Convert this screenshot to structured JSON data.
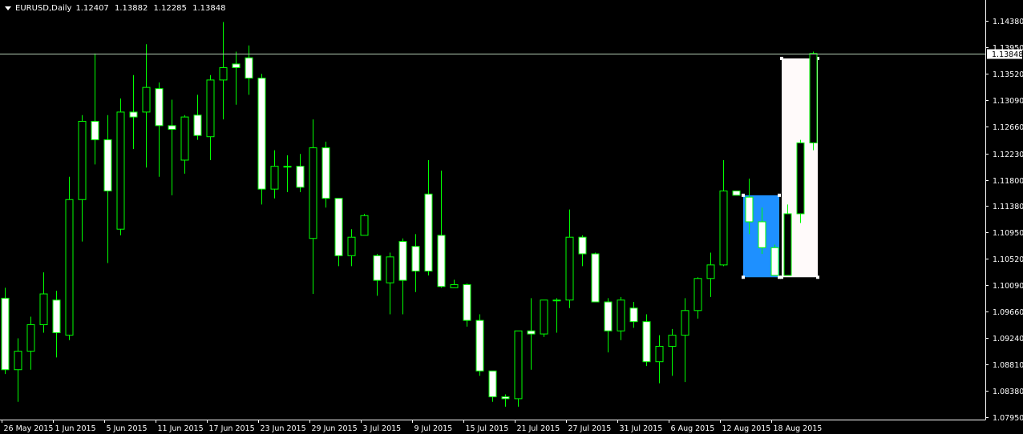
{
  "header": {
    "symbol_timeframe": "EURUSD,Daily",
    "open": "1.12407",
    "high": "1.13882",
    "low": "1.12285",
    "close": "1.13848"
  },
  "chart_data": {
    "type": "candlestick",
    "symbol": "EURUSD",
    "timeframe": "Daily",
    "ylim": [
      1.0775,
      1.1455
    ],
    "y_ticks": [
      "1.14380",
      "1.13950",
      "1.13520",
      "1.13090",
      "1.12660",
      "1.12230",
      "1.11800",
      "1.11380",
      "1.10950",
      "1.10520",
      "1.10090",
      "1.09660",
      "1.09240",
      "1.08810",
      "1.08380",
      "1.07950"
    ],
    "x_ticks": [
      {
        "label": "26 May 2015",
        "index": 0
      },
      {
        "label": "1 Jun 2015",
        "index": 4
      },
      {
        "label": "5 Jun 2015",
        "index": 8
      },
      {
        "label": "11 Jun 2015",
        "index": 12
      },
      {
        "label": "17 Jun 2015",
        "index": 16
      },
      {
        "label": "23 Jun 2015",
        "index": 20
      },
      {
        "label": "29 Jun 2015",
        "index": 24
      },
      {
        "label": "3 Jul 2015",
        "index": 28
      },
      {
        "label": "9 Jul 2015",
        "index": 32
      },
      {
        "label": "15 Jul 2015",
        "index": 36
      },
      {
        "label": "21 Jul 2015",
        "index": 40
      },
      {
        "label": "27 Jul 2015",
        "index": 44
      },
      {
        "label": "31 Jul 2015",
        "index": 48
      },
      {
        "label": "6 Aug 2015",
        "index": 52
      },
      {
        "label": "12 Aug 2015",
        "index": 56
      },
      {
        "label": "18 Aug 2015",
        "index": 60
      }
    ],
    "current_price": "1.13848",
    "current_price_value": 1.13848,
    "colors": {
      "background": "#000000",
      "bull_body": "#000000",
      "bear_body": "#ffffff",
      "candle_outline": "#00ff00",
      "axis": "#ffffff",
      "price_line": "#b4cdb4",
      "selection_blue": "#1e90ff",
      "selection_white": "#fffafa"
    },
    "candles": [
      {
        "o": 1.0988,
        "h": 1.1005,
        "l": 1.0865,
        "c": 1.0872
      },
      {
        "o": 1.0872,
        "h": 1.0923,
        "l": 1.082,
        "c": 1.0902
      },
      {
        "o": 1.0902,
        "h": 1.0958,
        "l": 1.0872,
        "c": 1.0945
      },
      {
        "o": 1.0945,
        "h": 1.103,
        "l": 1.0932,
        "c": 1.0995
      },
      {
        "o": 1.0985,
        "h": 1.1,
        "l": 1.0892,
        "c": 1.0932
      },
      {
        "o": 1.0928,
        "h": 1.1185,
        "l": 1.092,
        "c": 1.1148
      },
      {
        "o": 1.1148,
        "h": 1.1285,
        "l": 1.108,
        "c": 1.1275
      },
      {
        "o": 1.1275,
        "h": 1.1385,
        "l": 1.1205,
        "c": 1.1245
      },
      {
        "o": 1.1245,
        "h": 1.1285,
        "l": 1.1045,
        "c": 1.1162
      },
      {
        "o": 1.11,
        "h": 1.1312,
        "l": 1.109,
        "c": 1.129
      },
      {
        "o": 1.129,
        "h": 1.135,
        "l": 1.123,
        "c": 1.1282
      },
      {
        "o": 1.129,
        "h": 1.14,
        "l": 1.12,
        "c": 1.133
      },
      {
        "o": 1.1328,
        "h": 1.1338,
        "l": 1.1185,
        "c": 1.1268
      },
      {
        "o": 1.1268,
        "h": 1.131,
        "l": 1.1155,
        "c": 1.1262
      },
      {
        "o": 1.1212,
        "h": 1.1285,
        "l": 1.119,
        "c": 1.1282
      },
      {
        "o": 1.1285,
        "h": 1.1318,
        "l": 1.1245,
        "c": 1.1252
      },
      {
        "o": 1.125,
        "h": 1.135,
        "l": 1.1212,
        "c": 1.1342
      },
      {
        "o": 1.1342,
        "h": 1.1436,
        "l": 1.1278,
        "c": 1.1362
      },
      {
        "o": 1.1368,
        "h": 1.1388,
        "l": 1.1302,
        "c": 1.1362
      },
      {
        "o": 1.1378,
        "h": 1.1398,
        "l": 1.1318,
        "c": 1.1345
      },
      {
        "o": 1.1345,
        "h": 1.1352,
        "l": 1.114,
        "c": 1.1165
      },
      {
        "o": 1.1165,
        "h": 1.1228,
        "l": 1.115,
        "c": 1.1202
      },
      {
        "o": 1.1202,
        "h": 1.122,
        "l": 1.116,
        "c": 1.1202
      },
      {
        "o": 1.1202,
        "h": 1.1222,
        "l": 1.116,
        "c": 1.1168
      },
      {
        "o": 1.1085,
        "h": 1.1278,
        "l": 1.0995,
        "c": 1.1232
      },
      {
        "o": 1.1232,
        "h": 1.1242,
        "l": 1.1135,
        "c": 1.115
      },
      {
        "o": 1.115,
        "h": 1.115,
        "l": 1.104,
        "c": 1.1057
      },
      {
        "o": 1.1057,
        "h": 1.11,
        "l": 1.104,
        "c": 1.1087
      },
      {
        "o": 1.109,
        "h": 1.1125,
        "l": 1.109,
        "c": 1.1122
      },
      {
        "o": 1.1057,
        "h": 1.106,
        "l": 1.0992,
        "c": 1.1017
      },
      {
        "o": 1.1013,
        "h": 1.1062,
        "l": 1.0962,
        "c": 1.1055
      },
      {
        "o": 1.108,
        "h": 1.1085,
        "l": 1.0962,
        "c": 1.1017
      },
      {
        "o": 1.1072,
        "h": 1.1092,
        "l": 1.0998,
        "c": 1.1032
      },
      {
        "o": 1.1157,
        "h": 1.1212,
        "l": 1.1025,
        "c": 1.1032
      },
      {
        "o": 1.109,
        "h": 1.1195,
        "l": 1.1005,
        "c": 1.1007
      },
      {
        "o": 1.1005,
        "h": 1.1018,
        "l": 1.1005,
        "c": 1.101
      },
      {
        "o": 1.101,
        "h": 1.1012,
        "l": 1.0942,
        "c": 1.0952
      },
      {
        "o": 1.0952,
        "h": 1.0962,
        "l": 1.0862,
        "c": 1.087
      },
      {
        "o": 1.087,
        "h": 1.086,
        "l": 1.082,
        "c": 1.0828
      },
      {
        "o": 1.0828,
        "h": 1.0832,
        "l": 1.0812,
        "c": 1.0825
      },
      {
        "o": 1.0825,
        "h": 1.0935,
        "l": 1.0812,
        "c": 1.0935
      },
      {
        "o": 1.0935,
        "h": 1.0988,
        "l": 1.0872,
        "c": 1.093
      },
      {
        "o": 1.093,
        "h": 1.098,
        "l": 1.0925,
        "c": 1.0985
      },
      {
        "o": 1.0985,
        "h": 1.0988,
        "l": 1.0932,
        "c": 1.0985
      },
      {
        "o": 1.0985,
        "h": 1.1132,
        "l": 1.0972,
        "c": 1.1087
      },
      {
        "o": 1.1087,
        "h": 1.109,
        "l": 1.104,
        "c": 1.106
      },
      {
        "o": 1.106,
        "h": 1.1062,
        "l": 1.0982,
        "c": 1.0982
      },
      {
        "o": 1.0982,
        "h": 1.0988,
        "l": 1.09,
        "c": 1.0935
      },
      {
        "o": 1.0935,
        "h": 1.099,
        "l": 1.092,
        "c": 1.0985
      },
      {
        "o": 1.0972,
        "h": 1.0982,
        "l": 1.094,
        "c": 1.095
      },
      {
        "o": 1.095,
        "h": 1.0962,
        "l": 1.0878,
        "c": 1.0885
      },
      {
        "o": 1.0885,
        "h": 1.0928,
        "l": 1.085,
        "c": 1.091
      },
      {
        "o": 1.091,
        "h": 1.0938,
        "l": 1.0862,
        "c": 1.0928
      },
      {
        "o": 1.0928,
        "h": 1.0988,
        "l": 1.0852,
        "c": 1.0968
      },
      {
        "o": 1.0968,
        "h": 1.1022,
        "l": 1.0955,
        "c": 1.102
      },
      {
        "o": 1.102,
        "h": 1.1062,
        "l": 1.099,
        "c": 1.1042
      },
      {
        "o": 1.1042,
        "h": 1.1212,
        "l": 1.104,
        "c": 1.1162
      },
      {
        "o": 1.1162,
        "h": 1.1162,
        "l": 1.1155,
        "c": 1.1155
      },
      {
        "o": 1.1152,
        "h": 1.1182,
        "l": 1.1092,
        "c": 1.1112
      },
      {
        "o": 1.1112,
        "h": 1.1135,
        "l": 1.106,
        "c": 1.107
      },
      {
        "o": 1.107,
        "h": 1.1075,
        "l": 1.1025,
        "c": 1.1025
      },
      {
        "o": 1.1025,
        "h": 1.114,
        "l": 1.1025,
        "c": 1.1125
      },
      {
        "o": 1.1125,
        "h": 1.1245,
        "l": 1.111,
        "c": 1.124
      },
      {
        "o": 1.124,
        "h": 1.1388,
        "l": 1.1228,
        "c": 1.1385
      }
    ],
    "selections": [
      {
        "type": "rectangle",
        "color": "blue",
        "start_index": 58,
        "end_index": 60,
        "price_high": 1.1155,
        "price_low": 1.1022
      },
      {
        "type": "rectangle",
        "color": "white",
        "start_index": 61,
        "end_index": 63,
        "price_high": 1.1377,
        "price_low": 1.1022
      }
    ]
  }
}
